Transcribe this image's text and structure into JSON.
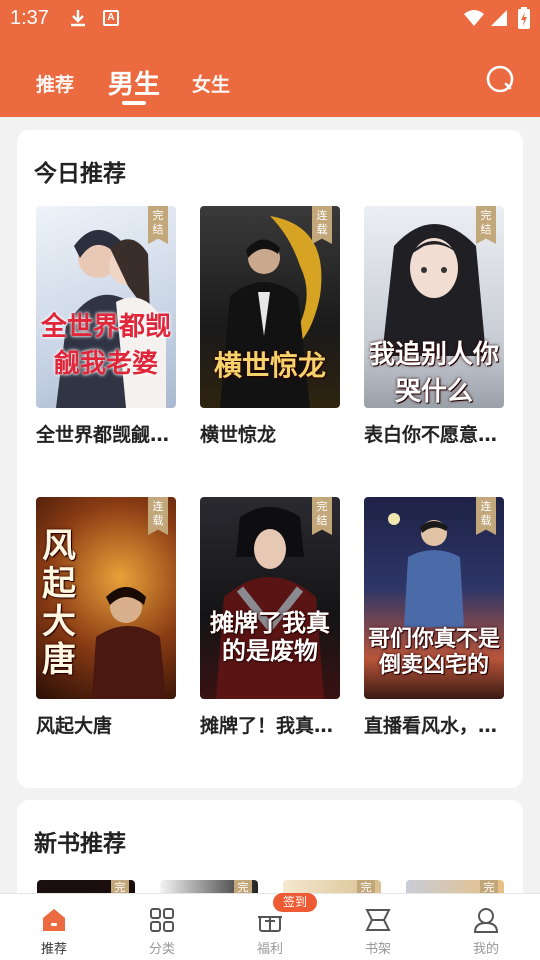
{
  "status_bar": {
    "time": "1:37",
    "font_icon_letter": "A"
  },
  "header": {
    "tabs": [
      {
        "label": "推荐"
      },
      {
        "label": "男生"
      },
      {
        "label": "女生"
      }
    ],
    "active_tab": "男生",
    "accent_color": "#ec6a3f"
  },
  "today": {
    "title": "今日推荐",
    "books": [
      {
        "name": "全世界都觊觎…",
        "badge": "完结",
        "cover_text": "全世界都觊觎我老婆",
        "cover_colors": [
          "#e8eef5",
          "#b9c7dc"
        ]
      },
      {
        "name": "横世惊龙",
        "badge": "连载",
        "cover_text": "横世惊龙",
        "cover_colors": [
          "#2a2a2a",
          "#b58a1c"
        ]
      },
      {
        "name": "表白你不愿意…",
        "badge": "完结",
        "cover_text": "我追别人你哭什么",
        "cover_colors": [
          "#dfe3ea",
          "#8c929c"
        ]
      },
      {
        "name": "风起大唐",
        "badge": "连载",
        "cover_text": "风起大唐",
        "cover_colors": [
          "#3a1a0e",
          "#c0701c"
        ]
      },
      {
        "name": "摊牌了！我真…",
        "badge": "完结",
        "cover_text": "摊牌了我真的是废物",
        "cover_colors": [
          "#1e1e22",
          "#8a2020"
        ]
      },
      {
        "name": "直播看风水，…",
        "badge": "连载",
        "cover_text": "哥们你真不是倒卖凶宅的",
        "cover_colors": [
          "#2a2f55",
          "#b8553a"
        ]
      }
    ]
  },
  "new_books": {
    "title": "新书推荐",
    "badges": [
      "完",
      "完",
      "完",
      "完"
    ]
  },
  "bottom_nav": {
    "items": [
      {
        "label": "推荐",
        "icon": "home-icon"
      },
      {
        "label": "分类",
        "icon": "grid-icon"
      },
      {
        "label": "福利",
        "icon": "gift-icon"
      },
      {
        "label": "书架",
        "icon": "bookshelf-icon"
      },
      {
        "label": "我的",
        "icon": "profile-icon"
      }
    ],
    "signin_badge": "签到"
  }
}
